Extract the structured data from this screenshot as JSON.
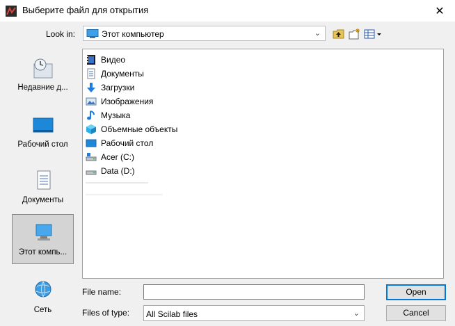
{
  "window": {
    "title": "Выберите файл для открытия",
    "close": "✕"
  },
  "toolbar": {
    "lookin_label": "Look in:",
    "lookin_value": "Этот компьютер"
  },
  "places": [
    {
      "label": "Недавние д...",
      "icon": "recent-places-icon"
    },
    {
      "label": "Рабочий стол",
      "icon": "desktop-icon"
    },
    {
      "label": "Документы",
      "icon": "documents-icon"
    },
    {
      "label": "Этот компь...",
      "icon": "this-pc-icon"
    },
    {
      "label": "Сеть",
      "icon": "network-icon"
    }
  ],
  "files": [
    {
      "label": "Видео",
      "icon": "video-folder-icon"
    },
    {
      "label": "Документы",
      "icon": "documents-folder-icon"
    },
    {
      "label": "Загрузки",
      "icon": "downloads-folder-icon"
    },
    {
      "label": "Изображения",
      "icon": "pictures-folder-icon"
    },
    {
      "label": "Музыка",
      "icon": "music-folder-icon"
    },
    {
      "label": "Объемные объекты",
      "icon": "3d-objects-folder-icon"
    },
    {
      "label": "Рабочий стол",
      "icon": "desktop-folder-icon"
    },
    {
      "label": "Acer (C:)",
      "icon": "drive-c-icon"
    },
    {
      "label": "Data (D:)",
      "icon": "drive-d-icon"
    }
  ],
  "form": {
    "filename_label": "File name:",
    "filename_value": "",
    "filetype_label": "Files of type:",
    "filetype_value": "All Scilab files"
  },
  "buttons": {
    "open": "Open",
    "cancel": "Cancel"
  }
}
